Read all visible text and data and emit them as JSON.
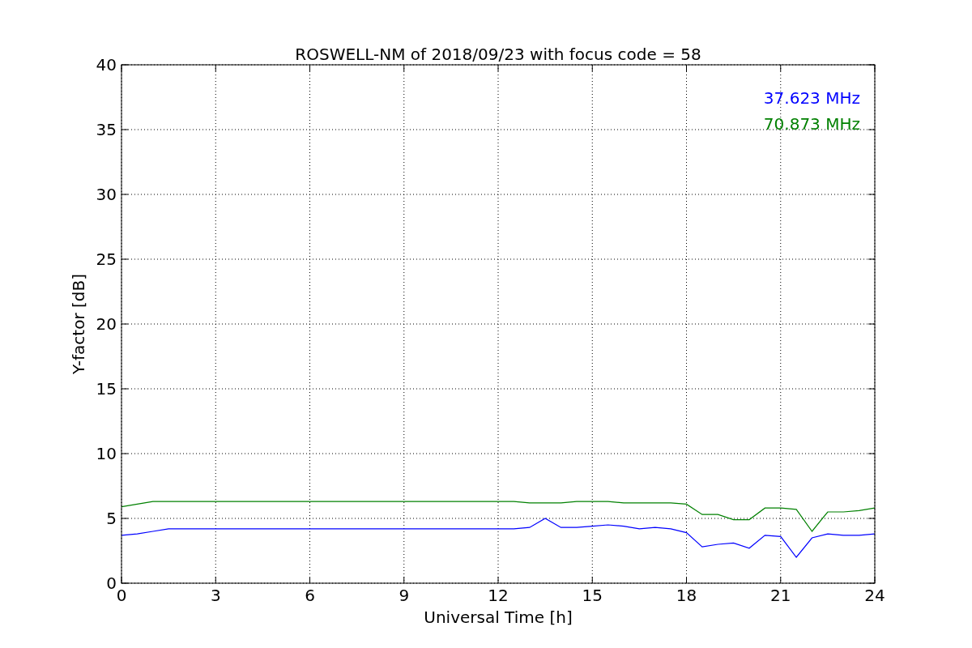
{
  "chart_data": {
    "type": "line",
    "title": "ROSWELL-NM of 2018/09/23 with focus code = 58",
    "xlabel": "Universal Time [h]",
    "ylabel": "Y-factor [dB]",
    "x": [
      0,
      0.5,
      1,
      1.5,
      2,
      2.5,
      3,
      3.5,
      4,
      4.5,
      5,
      5.5,
      6,
      6.5,
      7,
      7.5,
      8,
      8.5,
      9,
      9.5,
      10,
      10.5,
      11,
      11.5,
      12,
      12.5,
      13,
      13.5,
      14,
      14.5,
      15,
      15.5,
      16,
      16.5,
      17,
      17.5,
      18,
      18.5,
      19,
      19.5,
      20,
      20.5,
      21,
      21.5,
      22,
      22.5,
      23,
      23.5,
      24
    ],
    "series": [
      {
        "name": "37.623 MHz",
        "color": "#0000ff",
        "values": [
          3.7,
          3.8,
          4.0,
          4.2,
          4.2,
          4.2,
          4.2,
          4.2,
          4.2,
          4.2,
          4.2,
          4.2,
          4.2,
          4.2,
          4.2,
          4.2,
          4.2,
          4.2,
          4.2,
          4.2,
          4.2,
          4.2,
          4.2,
          4.2,
          4.2,
          4.2,
          4.3,
          5.0,
          4.3,
          4.3,
          4.4,
          4.5,
          4.4,
          4.2,
          4.3,
          4.2,
          3.9,
          2.8,
          3.0,
          3.1,
          2.7,
          3.7,
          3.6,
          2.0,
          3.5,
          3.8,
          3.7,
          3.7,
          3.8
        ]
      },
      {
        "name": "70.873 MHz",
        "color": "#008000",
        "values": [
          5.9,
          6.1,
          6.3,
          6.3,
          6.3,
          6.3,
          6.3,
          6.3,
          6.3,
          6.3,
          6.3,
          6.3,
          6.3,
          6.3,
          6.3,
          6.3,
          6.3,
          6.3,
          6.3,
          6.3,
          6.3,
          6.3,
          6.3,
          6.3,
          6.3,
          6.3,
          6.2,
          6.2,
          6.2,
          6.3,
          6.3,
          6.3,
          6.2,
          6.2,
          6.2,
          6.2,
          6.1,
          5.3,
          5.3,
          4.9,
          4.9,
          5.8,
          5.8,
          5.7,
          4.0,
          5.5,
          5.5,
          5.6,
          5.8
        ]
      }
    ],
    "grid": true,
    "xlim": [
      0,
      24
    ],
    "ylim": [
      0,
      40
    ],
    "xticks": [
      0,
      3,
      6,
      9,
      12,
      15,
      18,
      21,
      24
    ],
    "yticks": [
      0,
      5,
      10,
      15,
      20,
      25,
      30,
      35,
      40
    ]
  }
}
